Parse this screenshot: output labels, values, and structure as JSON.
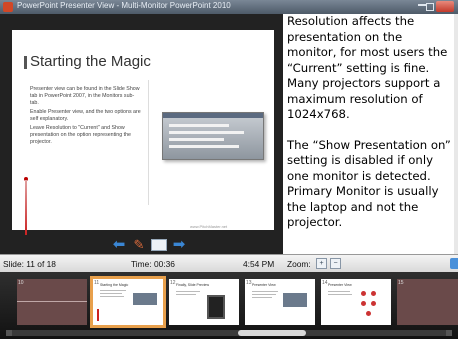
{
  "window": {
    "title": "PowerPoint Presenter View - Multi-Monitor PowerPoint 2010",
    "accent_color": "#d24726"
  },
  "slide": {
    "title": "Starting the Magic",
    "body": [
      "Presenter view can be found in the Slide Show tab in PowerPoint 2007, in the Monitors sub-tab.",
      "Enable Presenter view, and the two options are self explanatory.",
      "Leave Resolution to \"Current\" and Show presentation on the option representing the projector."
    ],
    "footer": "www.PitchMaster.net"
  },
  "notes": {
    "para1": "Resolution affects the presentation on the monitor, for most users the “Current” setting is fine. Many projectors support a maximum resolution of 1024x768.",
    "para2": "The “Show Presentation on” setting is disabled if only one monitor is detected. Primary Monitor is usually the laptop and not the projector."
  },
  "status": {
    "slide_count": "Slide: 11 of 18",
    "elapsed": "Time: 00:36",
    "clock": "4:54 PM",
    "zoom_label": "Zoom:"
  },
  "filmstrip": {
    "thumbnails": [
      {
        "number": "10",
        "title": "Presentation title"
      },
      {
        "number": "11",
        "title": "Starting the Magic"
      },
      {
        "number": "12",
        "title": "Finally, Slide Preview"
      },
      {
        "number": "13",
        "title": "Presenter View"
      },
      {
        "number": "14",
        "title": "Presenter View"
      },
      {
        "number": "15",
        "title": ""
      }
    ],
    "current_index": 1
  }
}
